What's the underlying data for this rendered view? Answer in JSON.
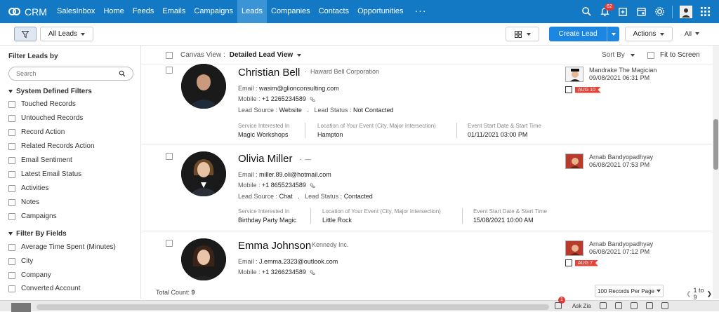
{
  "app": {
    "name": "CRM"
  },
  "nav": {
    "items": [
      "SalesInbox",
      "Home",
      "Feeds",
      "Emails",
      "Campaigns",
      "Leads",
      "Companies",
      "Contacts",
      "Opportunities"
    ],
    "active": "Leads",
    "more": "···",
    "notification_count": "62"
  },
  "toolbar": {
    "all_leads": "All Leads",
    "create_lead": "Create Lead",
    "actions": "Actions",
    "all": "All"
  },
  "sidebar": {
    "title": "Filter Leads by",
    "search_placeholder": "Search",
    "system_filters_title": "System Defined Filters",
    "system_filters": [
      "Touched Records",
      "Untouched Records",
      "Record Action",
      "Related Records Action",
      "Email Sentiment",
      "Latest Email Status",
      "Activities",
      "Notes",
      "Campaigns"
    ],
    "field_filters_title": "Filter By Fields",
    "field_filters": [
      "Average Time Spent (Minutes)",
      "City",
      "Company",
      "Converted Account"
    ]
  },
  "view": {
    "canvas_label": "Canvas View :",
    "canvas_value": "Detailed Lead View",
    "sort_by": "Sort By",
    "fit_to_screen": "Fit to Screen"
  },
  "labels": {
    "email": "Email :",
    "mobile": "Mobile :",
    "lead_source": "Lead Source :",
    "lead_status": "Lead Status :",
    "service": "Service Interested In",
    "location": "Location of Your Event (City, Major Intersection)",
    "event_start": "Event Start Date & Start Time",
    "sep": "."
  },
  "leads": [
    {
      "name": "Christian Bell",
      "company": "Haward Bell Corporation",
      "email": "wasim@glionconsulting.com",
      "mobile": "+1 2265234589",
      "lead_source": "Website",
      "lead_status": "Not Contacted",
      "service": "Magic Workshops",
      "location": "Hampton",
      "event_start": "01/11/2021 03:00 PM",
      "owner": "Mandrake The Magician",
      "owner_time": "09/08/2021 06:31 PM",
      "task_tag": "AUG 10"
    },
    {
      "name": "Olivia Miller",
      "company": "—",
      "email": "miller.89.oli@hotmail.com",
      "mobile": "+1 8655234589",
      "lead_source": "Chat",
      "lead_status": "Contacted",
      "service": "Birthday Party Magic",
      "location": "Little Rock",
      "event_start": "15/08/2021 10:00 AM",
      "owner": "Arnab Bandyopadhyay",
      "owner_time": "06/08/2021 07:53 PM"
    },
    {
      "name": "Emma Johnson",
      "company": "Kennedy Inc.",
      "email": "J.emma.2323@outlook.com",
      "mobile": "+1 3266234589",
      "owner": "Arnab Bandyopadhyay",
      "owner_time": "06/08/2021 07:12 PM",
      "task_tag": "AUG 7"
    }
  ],
  "footer": {
    "total_label": "Total Count:",
    "total_value": "9",
    "records_per_page": "100 Records Per Page",
    "pager": "1 to 9"
  },
  "bottom": {
    "ask_zia": "Ask Zia",
    "badge": "1"
  },
  "colors": {
    "topbar": "#1379c4",
    "primary_button": "#1d86e0",
    "tag": "#e8443a"
  }
}
